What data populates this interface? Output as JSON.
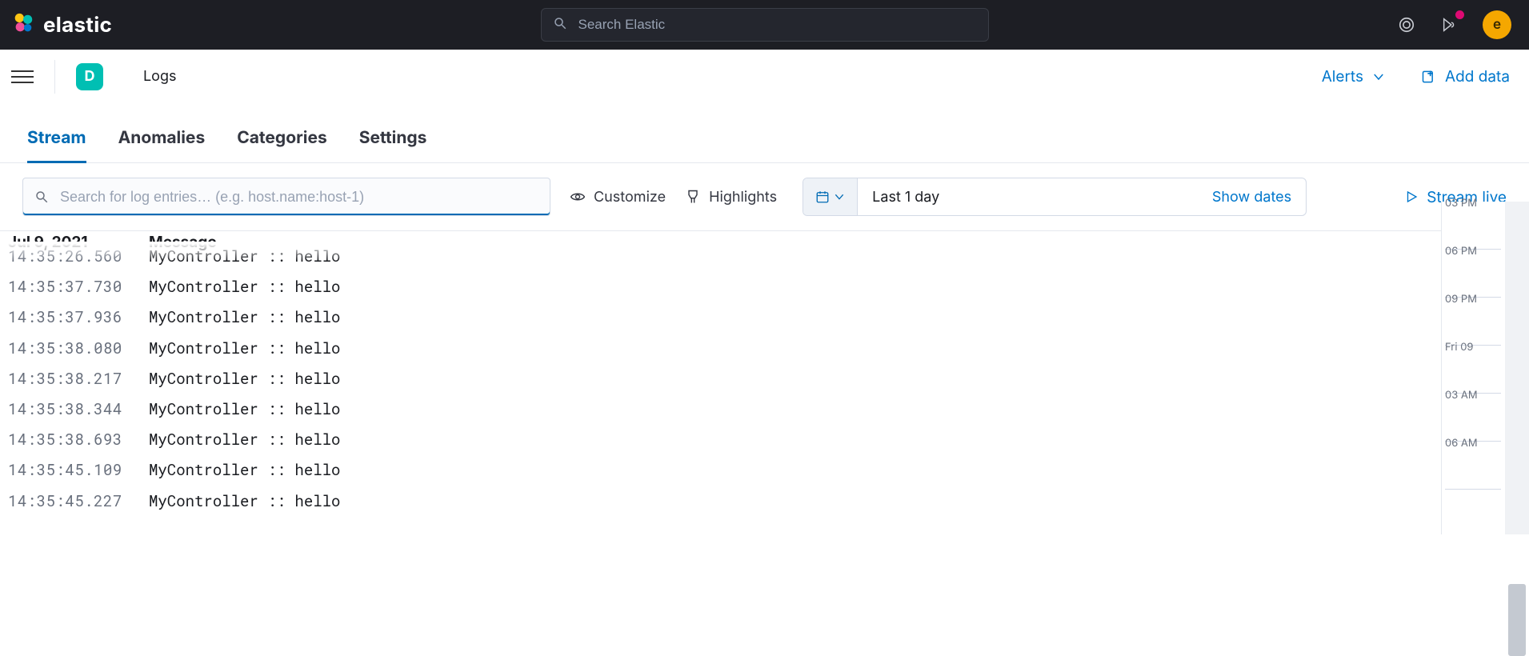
{
  "brand": {
    "word": "elastic",
    "avatar_initial": "e"
  },
  "top_search": {
    "placeholder": "Search Elastic"
  },
  "breadcrumb": {
    "space_initial": "D",
    "page": "Logs"
  },
  "header_actions": {
    "alerts": "Alerts",
    "add_data": "Add data"
  },
  "tabs": [
    {
      "label": "Stream",
      "active": true
    },
    {
      "label": "Anomalies",
      "active": false
    },
    {
      "label": "Categories",
      "active": false
    },
    {
      "label": "Settings",
      "active": false
    }
  ],
  "controls": {
    "search_placeholder": "Search for log entries… (e.g. host.name:host-1)",
    "customize": "Customize",
    "highlights": "Highlights",
    "date_label": "Last 1 day",
    "show_dates": "Show dates",
    "stream_live": "Stream live"
  },
  "log_header": {
    "date": "Jul 9, 2021",
    "message": "Message"
  },
  "log_rows": [
    {
      "ts": "14:35:26.560",
      "msg": "MyController :: hello",
      "truncated": true
    },
    {
      "ts": "14:35:37.730",
      "msg": "MyController :: hello"
    },
    {
      "ts": "14:35:37.936",
      "msg": "MyController :: hello"
    },
    {
      "ts": "14:35:38.080",
      "msg": "MyController :: hello"
    },
    {
      "ts": "14:35:38.217",
      "msg": "MyController :: hello"
    },
    {
      "ts": "14:35:38.344",
      "msg": "MyController :: hello"
    },
    {
      "ts": "14:35:38.693",
      "msg": "MyController :: hello"
    },
    {
      "ts": "14:35:45.109",
      "msg": "MyController :: hello"
    },
    {
      "ts": "14:35:45.227",
      "msg": "MyController :: hello"
    }
  ],
  "minimap_ticks": [
    "03 PM",
    "06 PM",
    "09 PM",
    "Fri 09",
    "03 AM",
    "06 AM"
  ],
  "colors": {
    "blue": "#006bb4",
    "accent": "#00bfb3",
    "notif": "#dd0a73"
  }
}
